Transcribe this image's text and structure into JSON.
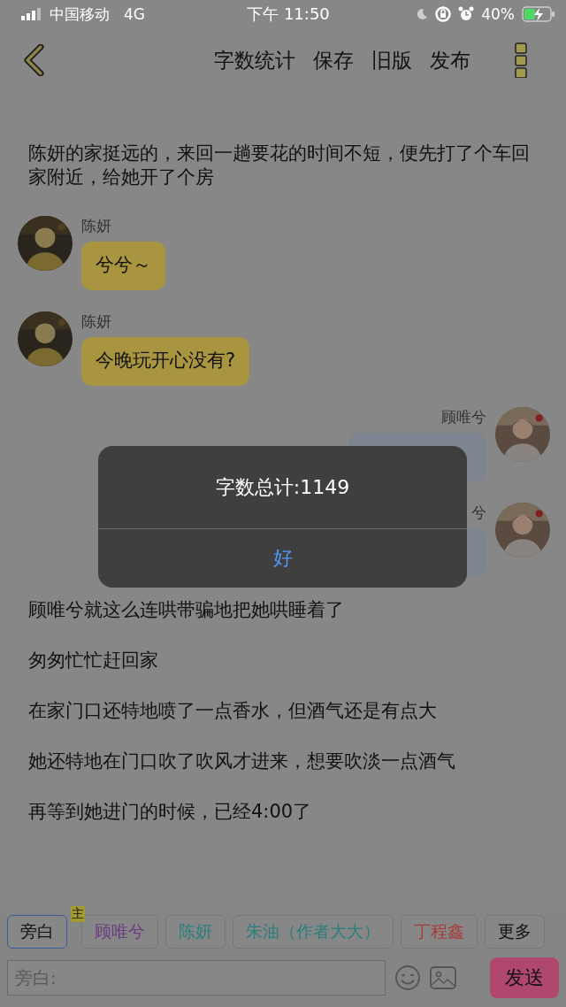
{
  "status_bar": {
    "carrier": "中国移动",
    "network": "4G",
    "time": "下午 11:50",
    "battery": "40%"
  },
  "nav": {
    "actions": [
      "字数统计",
      "保存",
      "旧版",
      "发布"
    ]
  },
  "content": [
    {
      "kind": "narration",
      "text": "陈妍的家挺远的，来回一趟要花的时间不短，便先打了个车回家附近，给她开了个房"
    },
    {
      "kind": "incoming",
      "name": "陈妍",
      "text": "兮兮～"
    },
    {
      "kind": "incoming",
      "name": "陈妍",
      "text": "今晚玩开心没有?"
    },
    {
      "kind": "outgoing",
      "name": "顾唯兮"
    },
    {
      "kind": "outgoing",
      "name": "兮"
    },
    {
      "kind": "narration",
      "text": "顾唯兮就这么连哄带骗地把她哄睡着了"
    },
    {
      "kind": "narration",
      "text": "匆匆忙忙赶回家"
    },
    {
      "kind": "narration",
      "text": "在家门口还特地喷了一点香水，但酒气还是有点大"
    },
    {
      "kind": "narration",
      "text": "她还特地在门口吹了吹风才进来，想要吹淡一点酒气"
    },
    {
      "kind": "narration",
      "text": "再等到她进门的时候，已经4:00了"
    }
  ],
  "alert": {
    "title": "字数总计:1149",
    "button": "好"
  },
  "roles": [
    {
      "label": "旁白",
      "selected": true,
      "color": "#111111"
    },
    {
      "label": "顾唯兮",
      "selected": false,
      "color": "#6a3a80",
      "badge": "主"
    },
    {
      "label": "陈妍",
      "selected": false,
      "color": "#2a7f7c"
    },
    {
      "label": "朱油（作者大大）",
      "selected": false,
      "color": "#2a7f7c"
    },
    {
      "label": "丁程鑫",
      "selected": false,
      "color": "#a83a3a"
    },
    {
      "label": "更多",
      "selected": false,
      "color": "#111111"
    }
  ],
  "input": {
    "placeholder": "旁白:",
    "send": "发送"
  }
}
